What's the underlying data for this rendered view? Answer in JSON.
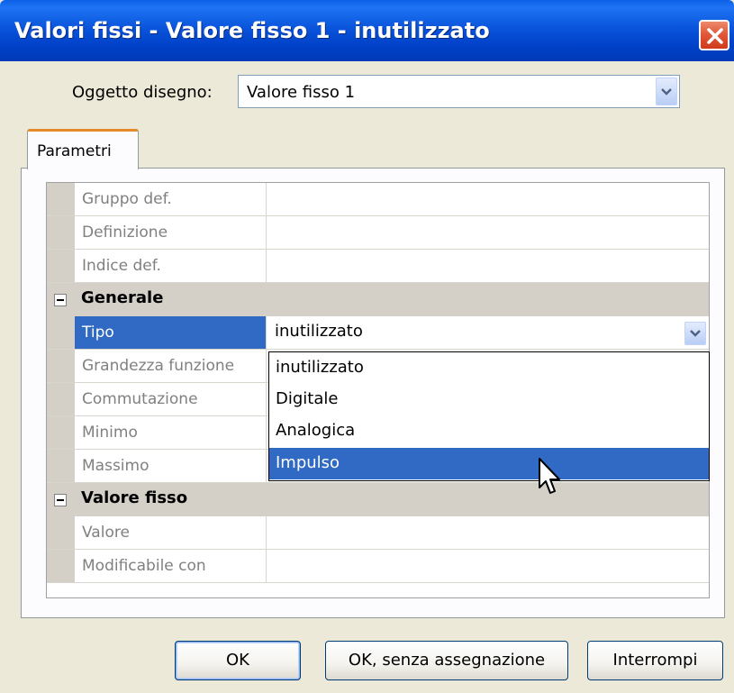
{
  "window": {
    "title": "Valori fissi - Valore fisso 1 - inutilizzato"
  },
  "object": {
    "label": "Oggetto disegno:",
    "value": "Valore fisso 1"
  },
  "tabs": [
    {
      "label": "Parametri",
      "active": true
    }
  ],
  "grid": {
    "rows": [
      {
        "name": "Gruppo def.",
        "value": ""
      },
      {
        "name": "Definizione",
        "value": ""
      },
      {
        "name": "Indice def.",
        "value": ""
      }
    ],
    "categories": [
      {
        "name": "Generale",
        "rows": [
          {
            "name": "Tipo",
            "value": "inutilizzato",
            "selected": true
          },
          {
            "name": "Grandezza funzione",
            "value": ""
          },
          {
            "name": "Commutazione",
            "value": ""
          },
          {
            "name": "Minimo",
            "value": ""
          },
          {
            "name": "Massimo",
            "value": ""
          }
        ]
      },
      {
        "name": "Valore fisso",
        "rows": [
          {
            "name": "Valore",
            "value": ""
          },
          {
            "name": "Modificabile con",
            "value": ""
          }
        ]
      }
    ]
  },
  "dropdown": {
    "options": [
      "inutilizzato",
      "Digitale",
      "Analogica",
      "Impulso"
    ],
    "highlighted": "Impulso"
  },
  "buttons": {
    "ok": "OK",
    "ok_no_assign": "OK, senza assegnazione",
    "cancel": "Interrompi"
  },
  "colors": {
    "titlebar": "#0a55dc",
    "selection": "#316ac5",
    "tab_accent": "#e68b2c",
    "close": "#e2583b"
  }
}
